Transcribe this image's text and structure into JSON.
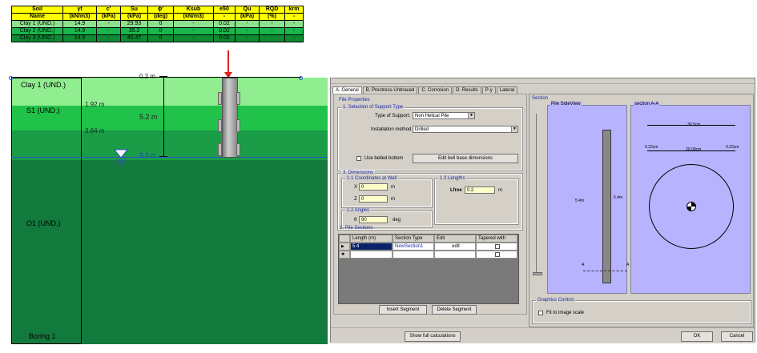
{
  "soil_table": {
    "header_row1": [
      "Soil",
      "γt",
      "c'",
      "Su",
      "ɸ'",
      "Ksub",
      "e50",
      "Qu",
      "RQD",
      "krm"
    ],
    "header_row2": [
      "Name",
      "(kN/m3)",
      "(kPa)",
      "(kPa)",
      "(deg)",
      "(kN/m3)",
      "-",
      "(kPa)",
      "(%)",
      "-"
    ],
    "rows": [
      [
        "Clay 1 (UND.)",
        "14.9",
        "-",
        "29.93",
        "0",
        "-",
        "0.02",
        "-",
        "-",
        "-"
      ],
      [
        "Clay 2 (UND.)",
        "14.9",
        "-",
        "35.2",
        "0",
        "-",
        "0.02",
        "-",
        "-",
        "-"
      ],
      [
        "Clay 3 (UND.)",
        "14.9",
        "-",
        "40.47",
        "0",
        "-",
        "0.02",
        "-",
        "-",
        "-"
      ]
    ]
  },
  "profile": {
    "layers": [
      "Clay 1 (UND.)",
      "S1 (UND.)",
      "O1 (UND.)"
    ],
    "depths": [
      "1.92 m",
      "3.64 m",
      "-5.5 m"
    ],
    "top_label": "0.2 m",
    "pile_length_label": "5.2 m",
    "boring_label": "Boring 1"
  },
  "dialog": {
    "tabs": [
      "A. General",
      "B. Prestress-Unbraced",
      "C. Corrosion",
      "D. Results",
      "P-y",
      "Lateral"
    ],
    "file_properties": "File Properties",
    "selection_title": "1. Selection of Support Type",
    "type_of_support_label": "Type of Support:",
    "type_of_support_value": "Non Helical Pile",
    "installation_label": "Installation method",
    "installation_value": "Drilled",
    "belled_label": "Use belled bottom",
    "edit_bell_button": "Edit bell base dimensions",
    "dimensions_title": "3. Dimensions",
    "coords_title": "1.1 Coordinates at Wall",
    "x_label": "X",
    "x_value": "0",
    "x_unit": "m",
    "z_label": "Z",
    "z_value": "0",
    "z_unit": "m",
    "lengths_title": "1.3 Lengths",
    "lfree_label": "Lfree",
    "lfree_value": "0.2",
    "lfree_unit": "m",
    "angles_title": "1.2 Angles",
    "angle_label": "θ",
    "angle_value": "90",
    "angle_unit": "deg",
    "pile_sections_title": "2. Pile Sections",
    "grid_headers": [
      "Length (m)",
      "Section Type",
      "Edit",
      "Tapered with"
    ],
    "grid_row1": [
      "5.4",
      "NewSection1",
      "edit"
    ],
    "insert_button": "Insert Segment",
    "delete_button": "Delete Segment",
    "section_title": "Section",
    "side_view_title": "Pile SideView",
    "section_aa_title": "section A-A",
    "side_len_left": "5.4m",
    "side_len_right": "5.4m",
    "a_label": "A",
    "dim_top": "30.5cm",
    "dim_left": "0.22cm",
    "dim_mid": "20.00cm",
    "dim_right": "0.22cm",
    "graphics_control": "Graphics Control",
    "fit_label": "Fit to image scale",
    "show_calc_button": "Show full calculations",
    "ok_button": "OK",
    "cancel_button": "Cancel"
  }
}
